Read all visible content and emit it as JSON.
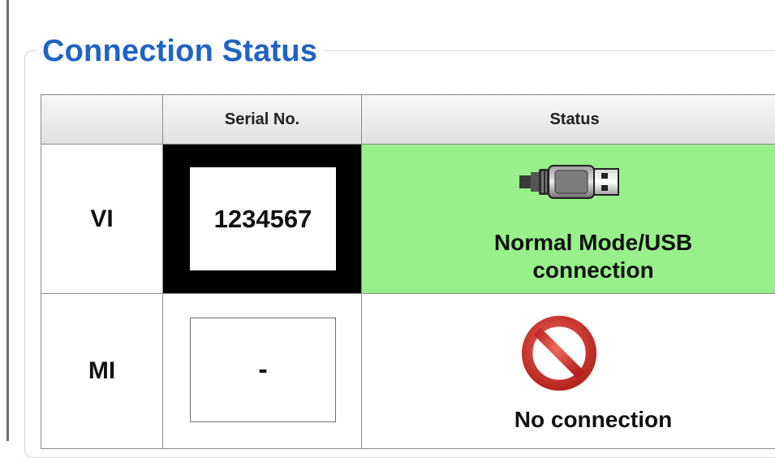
{
  "panel": {
    "title": "Connection Status"
  },
  "table": {
    "headers": {
      "device": "",
      "serial": "Serial No.",
      "status": "Status"
    },
    "rows": [
      {
        "device": "VI",
        "serial": "1234567",
        "status": "Normal Mode/USB connection",
        "status_icon": "usb-plug-icon",
        "highlight_color": "#98f08a"
      },
      {
        "device": "MI",
        "serial": "-",
        "status": "No connection",
        "status_icon": "no-symbol-icon"
      }
    ]
  },
  "colors": {
    "title_blue": "#1f63c4",
    "ok_green": "#98f08a",
    "no_red": "#d9322b"
  }
}
